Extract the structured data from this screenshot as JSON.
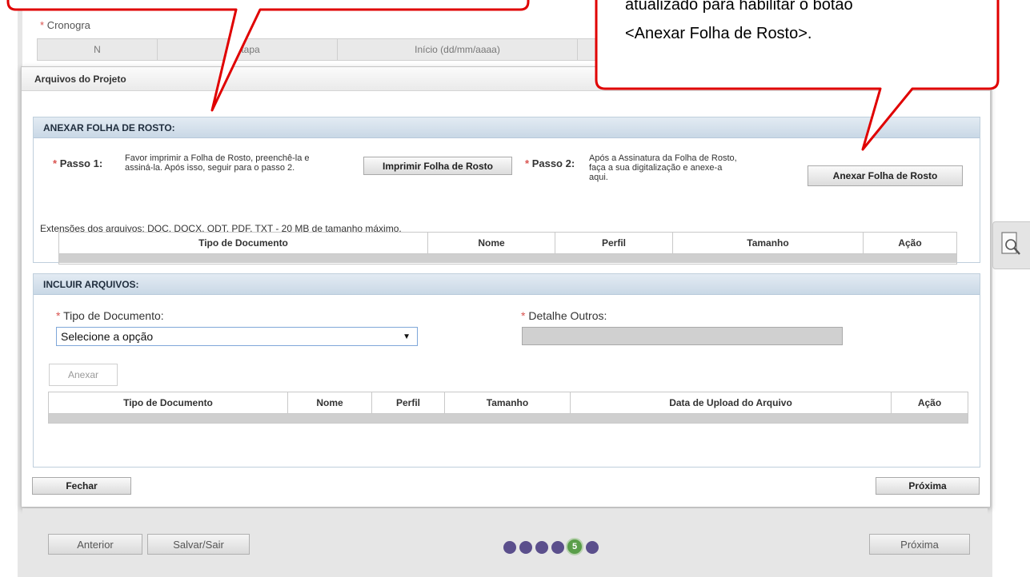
{
  "background": {
    "cronograma_label": "Cronogra",
    "table_headers": [
      "N",
      "Etapa",
      "Início (dd/mm/aaaa)",
      ""
    ]
  },
  "dialog": {
    "title": "Arquivos do Projeto",
    "close_icon": "close-icon",
    "section1": {
      "title": "ANEXAR FOLHA DE ROSTO:",
      "step1_label": "Passo 1:",
      "step1_text_line1": "Favor imprimir a Folha de Rosto, preenchê-la e",
      "step1_text_line2": "assiná-la. Após isso, seguir para o passo 2.",
      "print_button": "Imprimir Folha de Rosto",
      "step2_label": "Passo 2:",
      "step2_text_line1": "Após a Assinatura da Folha de Rosto,",
      "step2_text_line2": "faça a sua digitalização e anexe-a",
      "step2_text_line3": "aqui.",
      "attach_button": "Anexar Folha de Rosto",
      "extensions_note": "Extensões dos arquivos: DOC, DOCX, ODT, PDF, TXT - 20 MB de tamanho máximo.",
      "table_headers": [
        "Tipo de Documento",
        "Nome",
        "Perfil",
        "Tamanho",
        "Ação"
      ]
    },
    "section2": {
      "title": "INCLUIR ARQUIVOS:",
      "doc_type_label": "Tipo de Documento:",
      "doc_type_value": "Selecione a opção",
      "detail_label": "Detalhe Outros:",
      "attach_button": "Anexar",
      "table_headers": [
        "Tipo de Documento",
        "Nome",
        "Perfil",
        "Tamanho",
        "Data de Upload do Arquivo",
        "Ação"
      ]
    },
    "close_button": "Fechar",
    "next_button": "Próxima"
  },
  "bottom_bar": {
    "prev_button": "Anterior",
    "save_exit_button": "Salvar/Sair",
    "next_button": "Próxima",
    "current_step": "5"
  },
  "callouts": {
    "right_line1": "atualizado para habilitar o botão",
    "right_line2": "<Anexar Folha de Rosto>."
  },
  "colors": {
    "callout_border": "#e00000",
    "section_header": "#c9d8e6",
    "step_dot": "#5b4f8c",
    "step_active": "#5a9e4a",
    "required": "#d9534f"
  }
}
